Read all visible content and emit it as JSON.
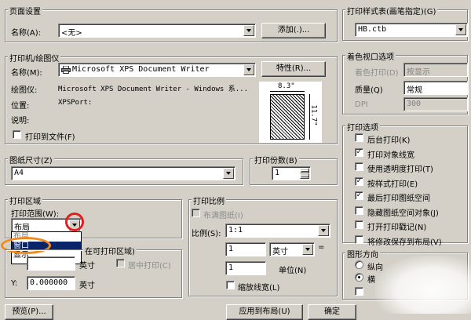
{
  "page_setup": {
    "group_label": "页面设置",
    "name_label": "名称(A):",
    "name_value": "<无>",
    "add_button": "添加(.)..."
  },
  "printer": {
    "group_label": "打印机/绘图仪",
    "name_label": "名称(M):",
    "name_value": "Microsoft XPS Document Writer",
    "properties_button": "特性(R)...",
    "plotter_label": "绘图仪:",
    "plotter_value": "Microsoft XPS Document Writer - Windows 系...",
    "location_label": "位置:",
    "location_value": "XPSPort:",
    "description_label": "说明:",
    "print_to_file_label": "打印到文件(F)",
    "preview_width": "8.3\"",
    "preview_height": "11.7\""
  },
  "paper_size": {
    "group_label": "图纸尺寸(Z)",
    "value": "A4"
  },
  "copies": {
    "group_label": "打印份数(B)",
    "value": "1"
  },
  "print_area": {
    "group_label": "打印区域",
    "range_label": "打印范围(W):",
    "range_value": "布局",
    "dropdown_options": [
      "布局",
      "窗口",
      "显示"
    ],
    "selected_option": "窗口"
  },
  "offset": {
    "group_label": "在可打印区域)",
    "center_label": "居中打印(C)",
    "x_unit": "英寸",
    "y_label": "Y:",
    "y_value": "0.000000",
    "y_unit": "英寸"
  },
  "scale": {
    "group_label": "打印比例",
    "fit_label": "布满图纸(I)",
    "scale_label": "比例(S):",
    "scale_value": "1:1",
    "value1": "1",
    "unit_value": "英寸",
    "equals": "=",
    "value2": "1",
    "unit_label": "单位(N)",
    "lineweights_label": "缩放线宽(L)"
  },
  "style_table": {
    "group_label": "打印样式表(画笔指定)(G)",
    "value": "HB.ctb"
  },
  "shaded": {
    "group_label": "着色视口选项",
    "shade_label": "着色打印(D)",
    "shade_value": "按显示",
    "quality_label": "质量(Q)",
    "quality_value": "常规",
    "dpi_label": "DPI",
    "dpi_value": "300"
  },
  "options": {
    "group_label": "打印选项",
    "items": [
      {
        "label": "后台打印(K)",
        "checked": false
      },
      {
        "label": "打印对象线宽",
        "checked": true
      },
      {
        "label": "使用透明度打印(T)",
        "checked": false
      },
      {
        "label": "按样式打印(E)",
        "checked": true
      },
      {
        "label": "最后打印图纸空间",
        "checked": true
      },
      {
        "label": "隐藏图纸空间对象(J)",
        "checked": false
      },
      {
        "label": "打开打印戳记(N)",
        "checked": false
      },
      {
        "label": "将修改保存到布局(V)",
        "checked": false
      }
    ]
  },
  "orientation": {
    "group_label": "图形方向",
    "portrait_label": "纵向",
    "landscape_label": "横"
  },
  "bottom": {
    "preview_button": "预览(P)...",
    "apply_button": "应用到布局(U)",
    "ok_button": "确定"
  },
  "colors": {
    "annotation_red": "#e0201c",
    "annotation_orange": "#f08a1c",
    "selection": "#0a246a"
  }
}
